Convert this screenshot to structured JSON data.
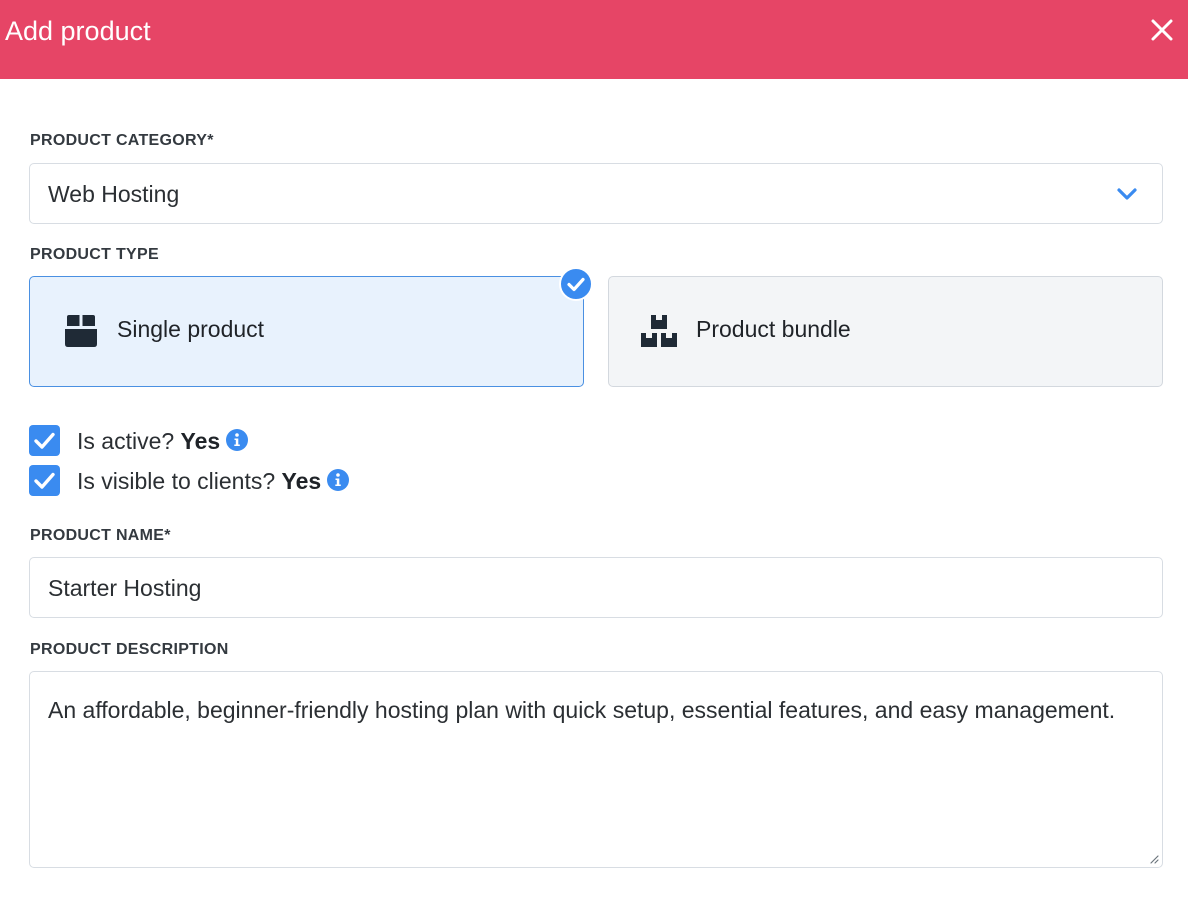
{
  "header": {
    "title": "Add product"
  },
  "category": {
    "label": "PRODUCT CATEGORY*",
    "value": "Web Hosting"
  },
  "product_type": {
    "label": "PRODUCT TYPE",
    "options": [
      {
        "label": "Single product",
        "selected": true
      },
      {
        "label": "Product bundle",
        "selected": false
      }
    ]
  },
  "toggles": {
    "active": {
      "label": "Is active?",
      "value": "Yes",
      "checked": true
    },
    "visible": {
      "label": "Is visible to clients?",
      "value": "Yes",
      "checked": true
    }
  },
  "name": {
    "label": "PRODUCT NAME*",
    "value": "Starter Hosting"
  },
  "description": {
    "label": "PRODUCT DESCRIPTION",
    "value": "An affordable, beginner-friendly hosting plan with quick setup, essential features, and easy management."
  },
  "colors": {
    "header": "#e64566",
    "accent": "#3a8bf0"
  }
}
